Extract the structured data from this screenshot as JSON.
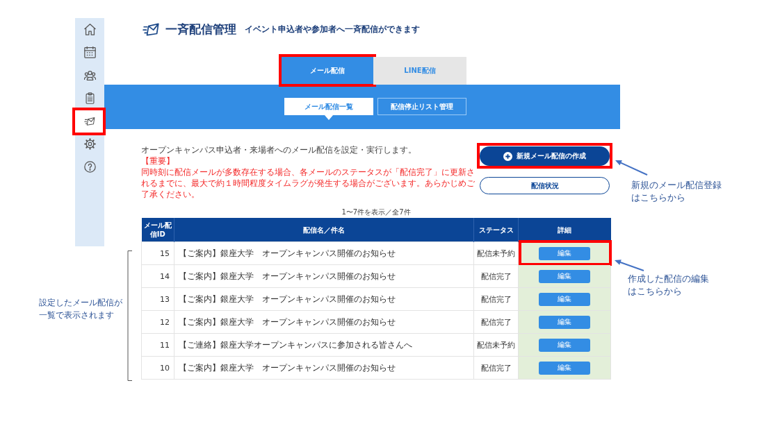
{
  "sidebar": {
    "items": [
      {
        "kind": "home",
        "selected": false,
        "highlighted": false
      },
      {
        "kind": "calendar",
        "selected": false,
        "highlighted": false
      },
      {
        "kind": "people",
        "selected": false,
        "highlighted": false
      },
      {
        "kind": "clipboard",
        "selected": false,
        "highlighted": false
      },
      {
        "kind": "mail",
        "selected": true,
        "highlighted": true
      },
      {
        "kind": "gear",
        "selected": false,
        "highlighted": false
      },
      {
        "kind": "help",
        "selected": false,
        "highlighted": false
      }
    ]
  },
  "header": {
    "title": "一斉配信管理",
    "subtitle": "イベント申込者や参加者へ一斉配信ができます"
  },
  "tabs": [
    {
      "label": "メール配信",
      "selected": true,
      "highlighted": true
    },
    {
      "label": "LINE配信",
      "selected": false,
      "highlighted": false
    }
  ],
  "subtabs": [
    {
      "label": "メール配信一覧",
      "selected": true
    },
    {
      "label": "配信停止リスト管理",
      "selected": false
    }
  ],
  "intro": {
    "description": "オープンキャンパス申込者・来場者へのメール配信を設定・実行します。",
    "notice_title": "【重要】",
    "notice": "同時刻に配信メールが多数存在する場合、各メールのステータスが「配信完了」に更新されるまでに、最大で約１時間程度タイムラグが発生する場合がございます。あらかじめご了承ください。"
  },
  "actions": [
    {
      "label": "新規メール配信の作成",
      "kind": "primary",
      "highlighted": true
    },
    {
      "label": "配信状況",
      "kind": "secondary",
      "highlighted": false
    }
  ],
  "result_count": "1〜7件を表示／全7件",
  "table": {
    "columns": [
      "メール配信ID",
      "配信名／件名",
      "ステータス",
      "詳細"
    ],
    "rows": [
      {
        "id": "15",
        "name": "【ご案内】銀座大学　オープンキャンパス開催のお知らせ",
        "status": "配信未予約",
        "action": "編集",
        "highlighted": true
      },
      {
        "id": "14",
        "name": "【ご案内】銀座大学　オープンキャンパス開催のお知らせ",
        "status": "配信完了",
        "action": "編集",
        "highlighted": false
      },
      {
        "id": "13",
        "name": "【ご案内】銀座大学　オープンキャンパス開催のお知らせ",
        "status": "配信完了",
        "action": "編集",
        "highlighted": false
      },
      {
        "id": "12",
        "name": "【ご案内】銀座大学　オープンキャンパス開催のお知らせ",
        "status": "配信完了",
        "action": "編集",
        "highlighted": false
      },
      {
        "id": "11",
        "name": "【ご連絡】銀座大学オープンキャンパスに参加される皆さんへ",
        "status": "配信未予約",
        "action": "編集",
        "highlighted": false
      },
      {
        "id": "10",
        "name": "【ご案内】銀座大学　オープンキャンパス開催のお知らせ",
        "status": "配信完了",
        "action": "編集",
        "highlighted": false
      }
    ]
  },
  "callouts": [
    {
      "kind": "arrow",
      "text": "新規のメール配信登録はこちらから"
    },
    {
      "kind": "arrow",
      "text": "作成した配信の編集はこちらから"
    },
    {
      "kind": "bracket",
      "text": "設定したメール配信が一覧で表示されます"
    }
  ]
}
